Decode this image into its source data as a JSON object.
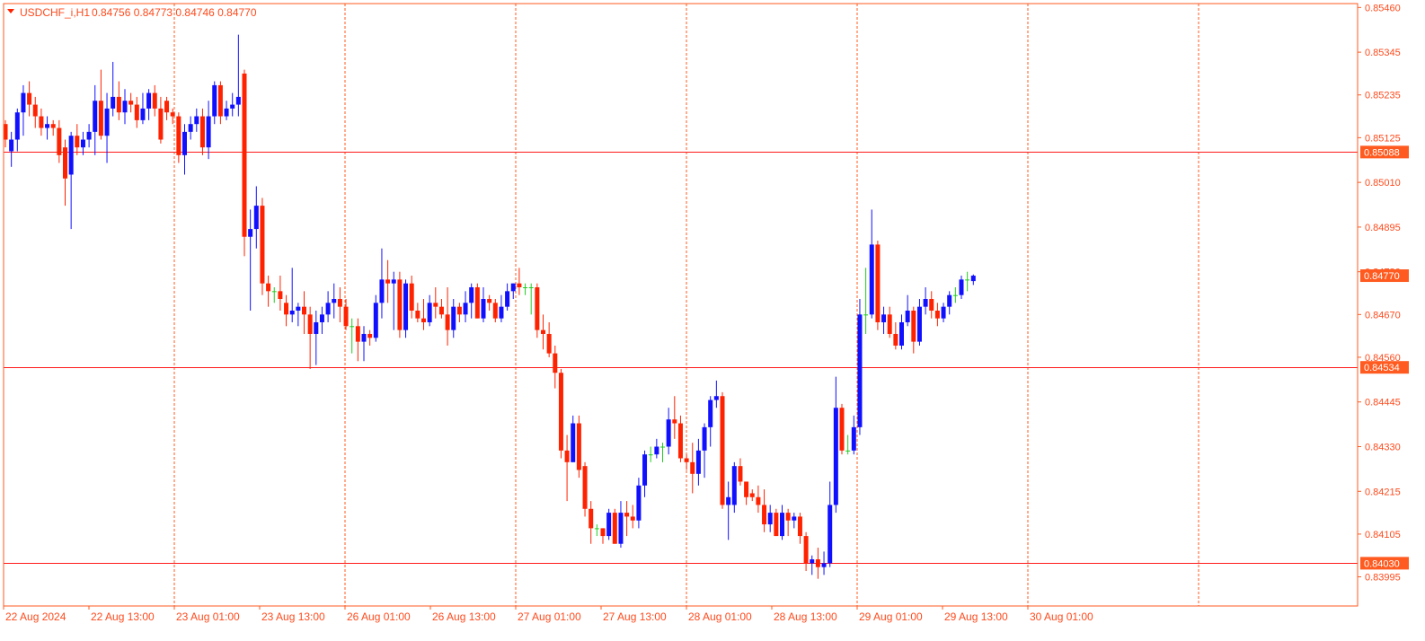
{
  "header": {
    "symbol": "USDCHF_i,H1",
    "ohlc": "0.84756 0.84773 0.84746 0.84770",
    "dropdown_icon": "triangle-down-icon"
  },
  "colors": {
    "background": "#ffffff",
    "frame": "#ff5a1f",
    "text": "#ff4a1c",
    "grid": "#ff5a1f",
    "bull": "#1010ff",
    "bear": "#ff2200",
    "doji": "#22cc22",
    "hline": "#ff1a1a",
    "price_tag_bg": "#ff5a1f",
    "price_tag_text": "#ffffff"
  },
  "chart_data": {
    "type": "candlestick",
    "title": "USDCHF_i,H1",
    "ylim": [
      0.8392,
      0.8547
    ],
    "y_ticks": [
      "0.85460",
      "0.85345",
      "0.85235",
      "0.85125",
      "0.85010",
      "0.84895",
      "0.84780",
      "0.84670",
      "0.84560",
      "0.84445",
      "0.84330",
      "0.84215",
      "0.84105",
      "0.83995"
    ],
    "x_ticks": [
      "22 Aug 2024",
      "22 Aug 13:00",
      "23 Aug 01:00",
      "23 Aug 13:00",
      "26 Aug 01:00",
      "26 Aug 13:00",
      "27 Aug 01:00",
      "27 Aug 13:00",
      "28 Aug 01:00",
      "28 Aug 13:00",
      "29 Aug 01:00",
      "29 Aug 13:00",
      "30 Aug 01:00"
    ],
    "vertical_separators": 7,
    "horizontal_levels": [
      {
        "value": 0.85088,
        "label": "0.85088"
      },
      {
        "value": 0.84534,
        "label": "0.84534"
      },
      {
        "value": 0.8403,
        "label": "0.84030"
      }
    ],
    "current_price": {
      "value": 0.8477,
      "label": "0.84770"
    },
    "candles": [
      [
        0.8516,
        0.8512,
        0.8517,
        0.851
      ],
      [
        0.8509,
        0.8512,
        0.8514,
        0.8505
      ],
      [
        0.8512,
        0.8519,
        0.852,
        0.8509
      ],
      [
        0.8519,
        0.8524,
        0.8526,
        0.8513
      ],
      [
        0.8524,
        0.8521,
        0.8527,
        0.8518
      ],
      [
        0.8521,
        0.8518,
        0.8523,
        0.8515
      ],
      [
        0.8518,
        0.8515,
        0.852,
        0.8513
      ],
      [
        0.8515,
        0.8516,
        0.8518,
        0.8512
      ],
      [
        0.8516,
        0.8515,
        0.8517,
        0.8513
      ],
      [
        0.8515,
        0.8508,
        0.8517,
        0.8506
      ],
      [
        0.851,
        0.8502,
        0.8512,
        0.8495
      ],
      [
        0.8503,
        0.8513,
        0.8514,
        0.8489
      ],
      [
        0.8513,
        0.851,
        0.8516,
        0.8508
      ],
      [
        0.851,
        0.8512,
        0.8514,
        0.8508
      ],
      [
        0.8512,
        0.8514,
        0.8516,
        0.851
      ],
      [
        0.8514,
        0.8522,
        0.8526,
        0.8508
      ],
      [
        0.8522,
        0.8513,
        0.853,
        0.8512
      ],
      [
        0.8513,
        0.852,
        0.8524,
        0.8506
      ],
      [
        0.852,
        0.8523,
        0.8532,
        0.8518
      ],
      [
        0.8523,
        0.8519,
        0.8527,
        0.8517
      ],
      [
        0.8519,
        0.8522,
        0.8525,
        0.8516
      ],
      [
        0.8522,
        0.8521,
        0.8524,
        0.8519
      ],
      [
        0.8521,
        0.8517,
        0.8523,
        0.8515
      ],
      [
        0.8517,
        0.852,
        0.8524,
        0.8516
      ],
      [
        0.852,
        0.8524,
        0.8525,
        0.8517
      ],
      [
        0.8524,
        0.852,
        0.8526,
        0.8518
      ],
      [
        0.852,
        0.8512,
        0.8523,
        0.8511
      ],
      [
        0.8522,
        0.8519,
        0.8523,
        0.8517
      ],
      [
        0.8519,
        0.8518,
        0.852,
        0.8516
      ],
      [
        0.8518,
        0.8508,
        0.8519,
        0.8506
      ],
      [
        0.8508,
        0.8514,
        0.8516,
        0.8503
      ],
      [
        0.8514,
        0.8516,
        0.8518,
        0.8512
      ],
      [
        0.8516,
        0.8518,
        0.852,
        0.8514
      ],
      [
        0.8518,
        0.851,
        0.852,
        0.8508
      ],
      [
        0.851,
        0.8518,
        0.8522,
        0.8507
      ],
      [
        0.8518,
        0.8526,
        0.8527,
        0.8516
      ],
      [
        0.8526,
        0.8518,
        0.8527,
        0.8516
      ],
      [
        0.8518,
        0.852,
        0.8522,
        0.8517
      ],
      [
        0.852,
        0.8521,
        0.8524,
        0.8518
      ],
      [
        0.8521,
        0.8523,
        0.8539,
        0.8518
      ],
      [
        0.8529,
        0.8487,
        0.853,
        0.8482
      ],
      [
        0.8487,
        0.8489,
        0.8494,
        0.8468
      ],
      [
        0.8489,
        0.8495,
        0.85,
        0.8484
      ],
      [
        0.8495,
        0.8475,
        0.8497,
        0.8472
      ],
      [
        0.8475,
        0.8473,
        0.8477,
        0.8469
      ],
      [
        0.8473,
        0.8473,
        0.8474,
        0.847
      ],
      [
        0.8473,
        0.8471,
        0.8477,
        0.8468
      ],
      [
        0.847,
        0.8467,
        0.8472,
        0.8464
      ],
      [
        0.8467,
        0.8468,
        0.8479,
        0.8465
      ],
      [
        0.8468,
        0.8469,
        0.847,
        0.8464
      ],
      [
        0.8469,
        0.8467,
        0.8473,
        0.8462
      ],
      [
        0.8467,
        0.8462,
        0.8469,
        0.8453
      ],
      [
        0.8462,
        0.8465,
        0.8468,
        0.8454
      ],
      [
        0.8465,
        0.8467,
        0.8469,
        0.8462
      ],
      [
        0.8467,
        0.847,
        0.8473,
        0.8465
      ],
      [
        0.847,
        0.8471,
        0.8475,
        0.8466
      ],
      [
        0.8471,
        0.8469,
        0.8474,
        0.8465
      ],
      [
        0.8469,
        0.8464,
        0.8471,
        0.8463
      ],
      [
        0.8464,
        0.8464,
        0.8466,
        0.8457
      ],
      [
        0.8464,
        0.846,
        0.8466,
        0.8455
      ],
      [
        0.846,
        0.8462,
        0.8464,
        0.8455
      ],
      [
        0.8462,
        0.8461,
        0.8463,
        0.8459
      ],
      [
        0.8461,
        0.847,
        0.8472,
        0.846
      ],
      [
        0.847,
        0.8476,
        0.8484,
        0.8466
      ],
      [
        0.8476,
        0.8475,
        0.8481,
        0.847
      ],
      [
        0.8475,
        0.8476,
        0.8478,
        0.8463
      ],
      [
        0.8476,
        0.8463,
        0.8478,
        0.8461
      ],
      [
        0.8463,
        0.8475,
        0.8476,
        0.8461
      ],
      [
        0.8475,
        0.8468,
        0.8477,
        0.8466
      ],
      [
        0.8468,
        0.8466,
        0.847,
        0.8465
      ],
      [
        0.8466,
        0.8465,
        0.8471,
        0.8463
      ],
      [
        0.8465,
        0.847,
        0.8472,
        0.8464
      ],
      [
        0.847,
        0.8469,
        0.8474,
        0.8466
      ],
      [
        0.8469,
        0.8467,
        0.8471,
        0.8466
      ],
      [
        0.8467,
        0.8463,
        0.8474,
        0.8459
      ],
      [
        0.8463,
        0.8469,
        0.8471,
        0.8461
      ],
      [
        0.8469,
        0.8467,
        0.847,
        0.8465
      ],
      [
        0.8467,
        0.847,
        0.8473,
        0.8465
      ],
      [
        0.847,
        0.8474,
        0.8475,
        0.8466
      ],
      [
        0.8474,
        0.8466,
        0.8475,
        0.8466
      ],
      [
        0.8466,
        0.8471,
        0.8474,
        0.8465
      ],
      [
        0.8471,
        0.847,
        0.8472,
        0.8468
      ],
      [
        0.847,
        0.8466,
        0.8471,
        0.8465
      ],
      [
        0.8466,
        0.8469,
        0.8472,
        0.8465
      ],
      [
        0.8469,
        0.8473,
        0.8475,
        0.8468
      ],
      [
        0.8473,
        0.8475,
        0.8475,
        0.8471
      ],
      [
        0.8475,
        0.8474,
        0.8479,
        0.8472
      ],
      [
        0.8474,
        0.8474,
        0.8475,
        0.8472
      ],
      [
        0.8474,
        0.8474,
        0.8475,
        0.8467
      ],
      [
        0.8474,
        0.8463,
        0.8475,
        0.8461
      ],
      [
        0.8463,
        0.8462,
        0.8467,
        0.8458
      ],
      [
        0.8462,
        0.8457,
        0.8465,
        0.8456
      ],
      [
        0.8457,
        0.8452,
        0.8459,
        0.8448
      ],
      [
        0.8452,
        0.8432,
        0.8453,
        0.843
      ],
      [
        0.8432,
        0.8429,
        0.8436,
        0.8419
      ],
      [
        0.8429,
        0.8439,
        0.8441,
        0.8429
      ],
      [
        0.8439,
        0.8427,
        0.8441,
        0.8425
      ],
      [
        0.8428,
        0.8417,
        0.8429,
        0.8415
      ],
      [
        0.8417,
        0.8412,
        0.8419,
        0.8408
      ],
      [
        0.8412,
        0.8412,
        0.8413,
        0.841
      ],
      [
        0.8412,
        0.841,
        0.8412,
        0.8408
      ],
      [
        0.841,
        0.8416,
        0.8417,
        0.8409
      ],
      [
        0.8416,
        0.8408,
        0.8417,
        0.8408
      ],
      [
        0.8408,
        0.8416,
        0.8419,
        0.8407
      ],
      [
        0.8416,
        0.8415,
        0.8419,
        0.841
      ],
      [
        0.8415,
        0.8414,
        0.8418,
        0.8412
      ],
      [
        0.8414,
        0.8423,
        0.8425,
        0.8412
      ],
      [
        0.8423,
        0.8431,
        0.8432,
        0.842
      ],
      [
        0.8431,
        0.8431,
        0.8433,
        0.8429
      ],
      [
        0.8431,
        0.8433,
        0.8435,
        0.843
      ],
      [
        0.8433,
        0.8433,
        0.8434,
        0.8429
      ],
      [
        0.8433,
        0.844,
        0.8443,
        0.8431
      ],
      [
        0.844,
        0.8439,
        0.8446,
        0.8435
      ],
      [
        0.8439,
        0.843,
        0.8441,
        0.8429
      ],
      [
        0.843,
        0.8429,
        0.8431,
        0.8427
      ],
      [
        0.8429,
        0.8426,
        0.8434,
        0.8421
      ],
      [
        0.8426,
        0.8432,
        0.8435,
        0.8423
      ],
      [
        0.8432,
        0.8438,
        0.8439,
        0.8425
      ],
      [
        0.8438,
        0.8445,
        0.8446,
        0.8433
      ],
      [
        0.8445,
        0.8446,
        0.845,
        0.8443
      ],
      [
        0.8446,
        0.8418,
        0.8447,
        0.8417
      ],
      [
        0.8418,
        0.842,
        0.8424,
        0.8409
      ],
      [
        0.8418,
        0.8428,
        0.8429,
        0.8416
      ],
      [
        0.8428,
        0.8424,
        0.843,
        0.8423
      ],
      [
        0.8424,
        0.842,
        0.8424,
        0.8418
      ],
      [
        0.8421,
        0.842,
        0.8422,
        0.8419
      ],
      [
        0.842,
        0.8418,
        0.8423,
        0.8416
      ],
      [
        0.8418,
        0.8413,
        0.8422,
        0.8411
      ],
      [
        0.8413,
        0.8416,
        0.8418,
        0.8411
      ],
      [
        0.8416,
        0.841,
        0.8417,
        0.841
      ],
      [
        0.841,
        0.8416,
        0.8418,
        0.8409
      ],
      [
        0.8416,
        0.8414,
        0.8417,
        0.841
      ],
      [
        0.8414,
        0.8415,
        0.8416,
        0.8412
      ],
      [
        0.8415,
        0.841,
        0.8416,
        0.8408
      ],
      [
        0.841,
        0.8403,
        0.8411,
        0.8401
      ],
      [
        0.8403,
        0.8404,
        0.8405,
        0.84
      ],
      [
        0.8404,
        0.8402,
        0.8407,
        0.8399
      ],
      [
        0.8402,
        0.8403,
        0.8406,
        0.84
      ],
      [
        0.8403,
        0.8418,
        0.8424,
        0.8402
      ],
      [
        0.8418,
        0.8443,
        0.8451,
        0.8416
      ],
      [
        0.8443,
        0.8432,
        0.8444,
        0.8431
      ],
      [
        0.8432,
        0.8432,
        0.8436,
        0.8431
      ],
      [
        0.8432,
        0.8438,
        0.8441,
        0.8431
      ],
      [
        0.8438,
        0.8467,
        0.8471,
        0.8436
      ],
      [
        0.8467,
        0.8467,
        0.8479,
        0.8462
      ],
      [
        0.8467,
        0.8485,
        0.8494,
        0.8466
      ],
      [
        0.8485,
        0.8465,
        0.8486,
        0.8463
      ],
      [
        0.8465,
        0.8467,
        0.8469,
        0.8462
      ],
      [
        0.8467,
        0.8462,
        0.8469,
        0.8461
      ],
      [
        0.8462,
        0.8459,
        0.8465,
        0.8458
      ],
      [
        0.8459,
        0.8465,
        0.8467,
        0.8458
      ],
      [
        0.8465,
        0.8468,
        0.8472,
        0.8464
      ],
      [
        0.8468,
        0.846,
        0.8469,
        0.8457
      ],
      [
        0.846,
        0.8469,
        0.8471,
        0.8459
      ],
      [
        0.8469,
        0.8471,
        0.8474,
        0.8467
      ],
      [
        0.8471,
        0.8468,
        0.8473,
        0.8466
      ],
      [
        0.8468,
        0.8466,
        0.847,
        0.8464
      ],
      [
        0.8466,
        0.8469,
        0.847,
        0.8465
      ],
      [
        0.8469,
        0.8472,
        0.8473,
        0.8467
      ],
      [
        0.8472,
        0.8472,
        0.8474,
        0.847
      ],
      [
        0.8472,
        0.8476,
        0.8477,
        0.8471
      ],
      [
        0.8476,
        0.8476,
        0.8478,
        0.8473
      ],
      [
        0.84756,
        0.8477,
        0.84773,
        0.84746
      ]
    ]
  }
}
